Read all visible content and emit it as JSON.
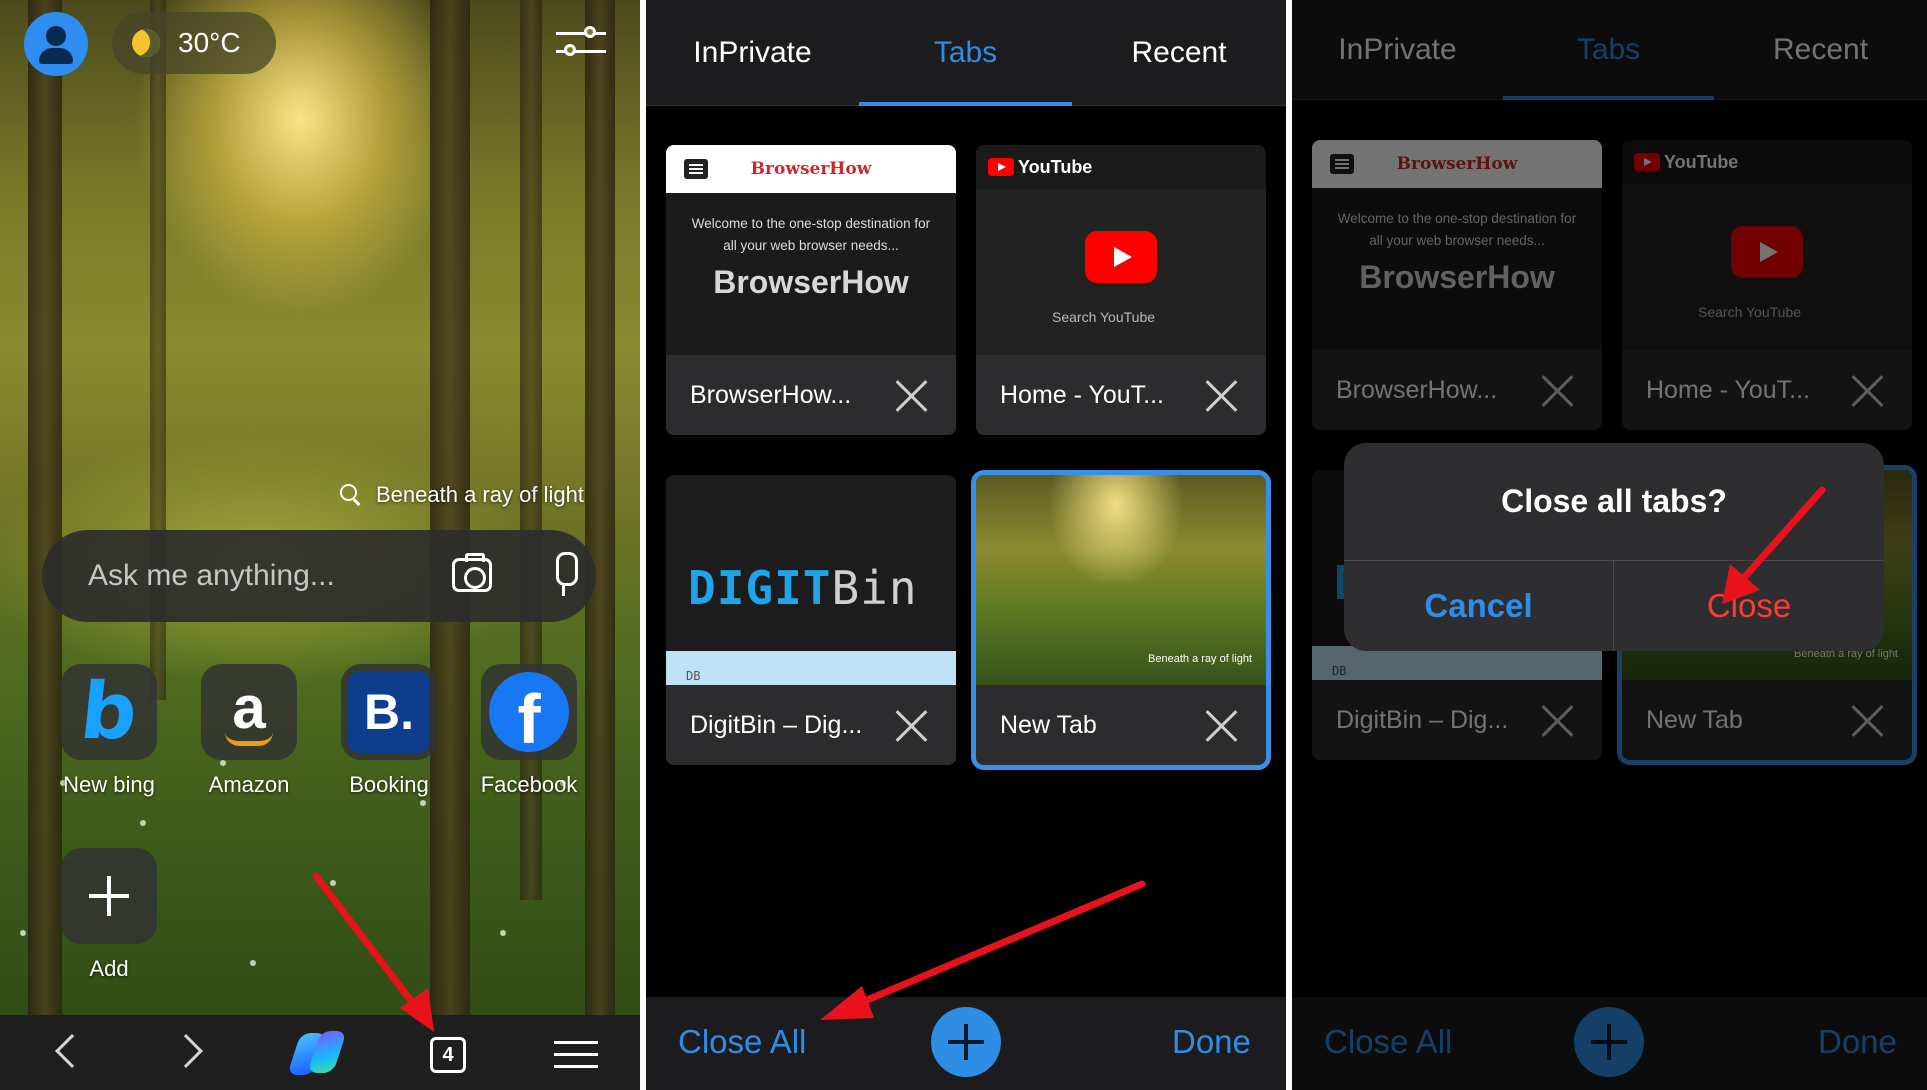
{
  "home": {
    "weather": "30°C",
    "background_caption": "Beneath a ray of light",
    "search_placeholder": "Ask me anything...",
    "shortcuts": [
      {
        "label": "New bing"
      },
      {
        "label": "Amazon"
      },
      {
        "label": "Booking"
      },
      {
        "label": "Facebook"
      },
      {
        "label": "Add"
      }
    ],
    "tab_count": "4"
  },
  "tabs_view": {
    "segments": [
      "InPrivate",
      "Tabs",
      "Recent"
    ],
    "active_segment": "Tabs",
    "cards": [
      {
        "title": "BrowserHow...",
        "site_name": "BrowserHow",
        "preview_text": "Welcome to the one-stop destination for all your web browser needs...",
        "preview_heading": "BrowserHow"
      },
      {
        "title": "Home - YouT...",
        "site_name": "YouTube",
        "preview_text": "Search YouTube"
      },
      {
        "title": "DigitBin – Dig...",
        "logo_part1": "DIGIT",
        "logo_part2": "Bin",
        "strip_text": "DB"
      },
      {
        "title": "New Tab",
        "preview_text": "Beneath a ray of light",
        "selected": true
      }
    ],
    "close_all_label": "Close All",
    "done_label": "Done"
  },
  "dialog": {
    "question": "Close all tabs?",
    "cancel_label": "Cancel",
    "confirm_label": "Close"
  },
  "colors": {
    "accent": "#2f8de4",
    "destructive": "#ff3b30",
    "annotation_arrow": "#e8121c"
  }
}
